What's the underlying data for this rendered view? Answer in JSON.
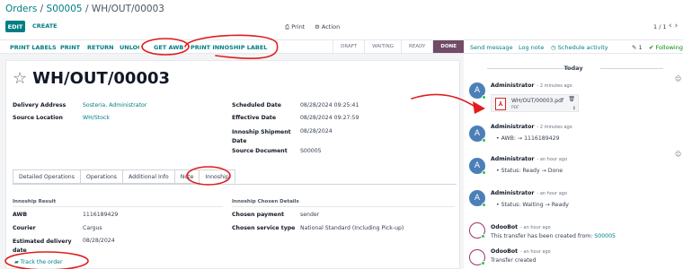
{
  "breadcrumb": {
    "orders": "Orders",
    "so": "S00005",
    "current": "WH/OUT/00003",
    "sep": " / "
  },
  "control_panel": {
    "edit": "EDIT",
    "create": "CREATE",
    "print": "Print",
    "action": "Action",
    "pager": "1 / 1"
  },
  "status_buttons": [
    "PRINT LABELS",
    "PRINT",
    "RETURN",
    "UNLOCK",
    "GET AWB",
    "PRINT INNOSHIP LABEL"
  ],
  "stages": [
    "DRAFT",
    "WAITING",
    "READY",
    "DONE"
  ],
  "chatter_bar": {
    "send": "Send message",
    "log": "Log note",
    "schedule": "Schedule activity",
    "attach_count": "1",
    "following": "Following"
  },
  "form": {
    "title": "WH/OUT/00003",
    "left_fields": [
      {
        "label": "Delivery Address",
        "value": "Sosteria, Administrator"
      },
      {
        "label": "Source Location",
        "value": "WH/Stock"
      }
    ],
    "right_fields": [
      {
        "label": "Scheduled Date",
        "value": "08/28/2024 09:25:41"
      },
      {
        "label": "Effective Date",
        "value": "08/28/2024 09:27:59"
      },
      {
        "label": "Innoship Shipment Date",
        "value": "08/28/2024"
      },
      {
        "label": "Source Document",
        "value": "S00005"
      }
    ],
    "tabs": [
      "Detailed Operations",
      "Operations",
      "Additional Info",
      "Note",
      "Innoship"
    ],
    "innoship_result": {
      "heading": "Innoship Result",
      "rows": [
        {
          "label": "AWB",
          "value": "1116189429"
        },
        {
          "label": "Courier",
          "value": "Cargus"
        },
        {
          "label": "Estimated delivery date",
          "value": "08/28/2024"
        }
      ]
    },
    "innoship_chosen": {
      "heading": "Innoship Chosen Details",
      "rows": [
        {
          "label": "Chosen payment",
          "value": "sender"
        },
        {
          "label": "Chosen service type",
          "value": "National Standard (Including Pick-up)"
        }
      ]
    },
    "track_link": "Track the order"
  },
  "chatter": {
    "today": "Today",
    "messages": [
      {
        "author": "Administrator",
        "ago": "- 2 minutes ago",
        "attachment": {
          "name": "WH/OUT/00003.pdf",
          "type": "PDF"
        }
      },
      {
        "author": "Administrator",
        "ago": "- 2 minutes ago",
        "text": "AWB: → 1116189429"
      },
      {
        "author": "Administrator",
        "ago": "- an hour ago",
        "text": "Status: Ready → Done"
      },
      {
        "author": "Administrator",
        "ago": "- an hour ago",
        "text": "Status: Waiting → Ready"
      },
      {
        "author": "OdooBot",
        "ago": "- an hour ago",
        "text_prefix": "This transfer has been created from: ",
        "text_link": "S00005"
      },
      {
        "author": "OdooBot",
        "ago": "- an hour ago",
        "text": "Transfer created"
      }
    ]
  },
  "colors": {
    "primary": "#017e84",
    "done_stage": "#714b67",
    "annotation": "#e11d1d"
  }
}
